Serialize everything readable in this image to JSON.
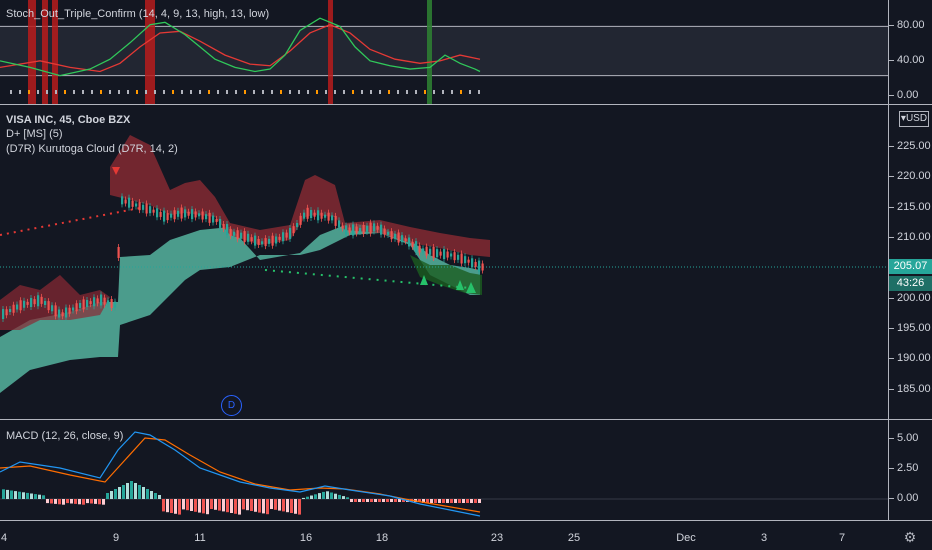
{
  "colors": {
    "bg": "#131722",
    "bull": "#26a69a",
    "bear": "#ef5350",
    "cloud_bull": "#5fc9b0",
    "cloud_bear": "#8b2a33",
    "stoch_k": "#30c85a",
    "stoch_d": "#e53935",
    "macd": "#2196f3",
    "signal": "#ff6d00",
    "price_line": "#26a69a"
  },
  "stoch_pane": {
    "title": "Stoch_Out_Triple_Confirm (14, 4, 9, 13, high, 13, low)",
    "ticks": [
      "80.00",
      "40.00",
      "0.00"
    ]
  },
  "main_pane": {
    "symbol": "VISA INC, 45, Cboe BZX",
    "indicator_1": "D+ [MS] (5)",
    "indicator_2": "(D7R) Kurutoga Cloud (D7R, 14, 2)",
    "currency": "USD",
    "ticks": [
      "225.00",
      "220.00",
      "215.00",
      "210.00",
      "200.00",
      "195.00",
      "190.00",
      "185.00"
    ],
    "last_price": "205.07",
    "countdown": "43:26",
    "dividend_marker": "D"
  },
  "macd_pane": {
    "title": "MACD (12, 26, close, 9)",
    "ticks": [
      "5.00",
      "2.50",
      "0.00"
    ]
  },
  "time_axis": [
    "4",
    "9",
    "11",
    "16",
    "18",
    "23",
    "25",
    "Dec",
    "3",
    "7"
  ],
  "icons": {
    "settings": "gear-icon",
    "currency": "dropdown-icon"
  },
  "chart_data": [
    {
      "type": "line",
      "title": "Stoch_Out_Triple_Confirm (14, 4, 9, 13, high, 13, low)",
      "ylim": [
        0,
        100
      ],
      "x": [
        "4",
        "9",
        "11",
        "16",
        "18",
        "23"
      ],
      "series": []
    },
    {
      "type": "candlestick",
      "title": "VISA INC, 45, Cboe BZX",
      "ylim": [
        183,
        230
      ],
      "x": [
        "4",
        "9",
        "11",
        "16",
        "18",
        "23"
      ],
      "series": [
        {
          "values": [
            196,
            199,
            215,
            214,
            213,
            212,
            211,
            207,
            205
          ]
        },
        {
          "values": [
            188,
            194,
            205,
            206,
            207,
            209,
            206,
            203,
            201
          ]
        }
      ],
      "last_price": 205.07
    },
    {
      "type": "bar",
      "title": "MACD (12, 26, close, 9)",
      "ylim": [
        -1.5,
        6
      ],
      "x": [
        "4",
        "9",
        "11",
        "16",
        "18",
        "23"
      ],
      "series": [
        {
          "values": [
            1.6,
            2.2,
            5.5,
            4.0,
            1.6,
            0.7,
            1.5,
            0.4,
            -0.5,
            -1.2
          ]
        },
        {
          "values": [
            1.0,
            1.6,
            4.3,
            4.8,
            2.5,
            1.0,
            0.8,
            0.5,
            0.2,
            -1.0
          ]
        }
      ]
    }
  ]
}
